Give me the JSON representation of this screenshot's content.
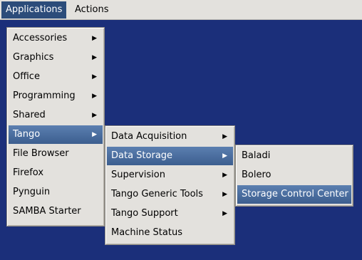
{
  "menubar": {
    "items": [
      {
        "label": "Applications"
      },
      {
        "label": "Actions"
      }
    ]
  },
  "applications_menu": {
    "items": [
      {
        "label": "Accessories",
        "submenu": true
      },
      {
        "label": "Graphics",
        "submenu": true
      },
      {
        "label": "Office",
        "submenu": true
      },
      {
        "label": "Programming",
        "submenu": true
      },
      {
        "label": "Shared",
        "submenu": true
      },
      {
        "label": "Tango",
        "submenu": true
      },
      {
        "label": "File Browser",
        "submenu": false
      },
      {
        "label": "Firefox",
        "submenu": false
      },
      {
        "label": "Pynguin",
        "submenu": false
      },
      {
        "label": "SAMBA Starter",
        "submenu": false
      }
    ]
  },
  "tango_menu": {
    "items": [
      {
        "label": "Data Acquisition",
        "submenu": true
      },
      {
        "label": "Data Storage",
        "submenu": true
      },
      {
        "label": "Supervision",
        "submenu": true
      },
      {
        "label": "Tango Generic Tools",
        "submenu": true
      },
      {
        "label": "Tango Support",
        "submenu": true
      },
      {
        "label": "Machine Status",
        "submenu": false
      }
    ]
  },
  "storage_menu": {
    "items": [
      {
        "label": "Baladi"
      },
      {
        "label": "Bolero"
      },
      {
        "label": "Storage Control Center"
      }
    ]
  },
  "icons": {
    "submenu_arrow": "chevron-right-icon",
    "arrow_glyph": "▶"
  },
  "colors": {
    "desktop": "#1b2f7a",
    "menu_bg": "#e3e1dd",
    "highlight": "#3c5e8f"
  }
}
